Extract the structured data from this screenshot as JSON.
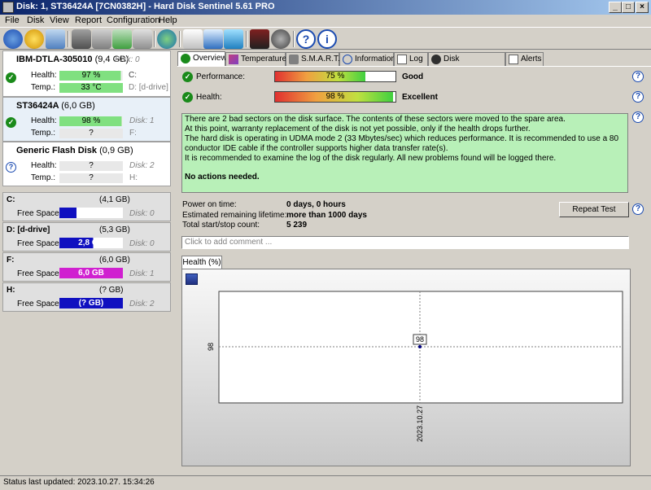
{
  "window": {
    "title": "Disk: 1, ST36424A [7CN0382H]  -  Hard Disk Sentinel 5.61 PRO"
  },
  "menu": [
    "File",
    "Disk",
    "View",
    "Report",
    "Configuration",
    "Help"
  ],
  "disks": [
    {
      "name": "IBM-DTLA-305010",
      "size": "(9,4 GB)",
      "disk_label": "Disk: 0",
      "health_label": "Health:",
      "health": "97 %",
      "health_fraction": 0.97,
      "temp_label": "Temp.:",
      "temp": "33 °C",
      "drive1": "C:",
      "drive2": "D: [d-drive]"
    },
    {
      "name": "ST36424A",
      "size": "(6,0 GB)",
      "disk_label": "Disk: 1",
      "health_label": "Health:",
      "health": "98 %",
      "health_fraction": 0.98,
      "temp_label": "Temp.:",
      "temp": "?",
      "drive1": "F:"
    },
    {
      "name": "Generic Flash Disk",
      "size": "(0,9 GB)",
      "disk_label": "Disk: 2",
      "health_label": "Health:",
      "health": "?",
      "temp_label": "Temp.:",
      "temp": "?",
      "drive1": "H:"
    }
  ],
  "volumes": [
    {
      "name": "C:",
      "size": "(4,1 GB)",
      "free_label": "Free Space",
      "free": "1,1 GB",
      "free_fraction": 0.27,
      "disk": "Disk: 0"
    },
    {
      "name": "D: [d-drive]",
      "size": "(5,3 GB)",
      "free_label": "Free Space",
      "free": "2,8 GB",
      "free_fraction": 0.53,
      "disk": "Disk: 0"
    },
    {
      "name": "F:",
      "size": "(6,0 GB)",
      "free_label": "Free Space",
      "free": "6,0 GB",
      "free_fraction": 1.0,
      "disk": "Disk: 1"
    },
    {
      "name": "H:",
      "size": "(? GB)",
      "free_label": "Free Space",
      "free": "(? GB)",
      "free_fraction": 0.0,
      "disk": "Disk: 2"
    }
  ],
  "tabs": [
    "Overview",
    "Temperature",
    "S.M.A.R.T.",
    "Information",
    "Log",
    "Disk Performance",
    "Alerts"
  ],
  "overview": {
    "performance_label": "Performance:",
    "performance": "75 %",
    "performance_fraction": 0.75,
    "performance_rating": "Good",
    "health_label": "Health:",
    "health": "98 %",
    "health_fraction": 0.98,
    "health_rating": "Excellent",
    "message_lines": [
      "There are 2 bad sectors on the disk surface. The contents of these sectors were moved to the spare area.",
      "At this point, warranty replacement of the disk is not yet possible, only if the health drops further.",
      "The hard disk is operating in UDMA mode 2 (33 Mbytes/sec) which reduces performance. It is recommended to use a 80",
      "conductor IDE cable if the controller supports higher data transfer rate(s).",
      "It is recommended to examine the log of the disk regularly. All new problems found will be logged there."
    ],
    "message_action": "No actions needed.",
    "power_on_label": "Power on time:",
    "power_on": "0 days, 0 hours",
    "lifetime_label": "Estimated remaining lifetime:",
    "lifetime": "more than 1000 days",
    "startstop_label": "Total start/stop count:",
    "startstop": "5 239",
    "repeat_test": "Repeat Test",
    "comment_placeholder": "Click to add comment ...",
    "chart_tab": "Health (%)"
  },
  "chart_data": {
    "type": "scatter",
    "x": [
      "2023.10.27"
    ],
    "values": [
      98
    ],
    "ytick": "98",
    "xtick": "2023.10.27",
    "point_label": "98"
  },
  "status": "Status last updated: 2023.10.27. 15:34:26",
  "colors": {
    "health_green": "#80e080",
    "free_blue": "#1010c0",
    "free_magenta": "#d020d0",
    "message_bg": "#b8f0b8"
  }
}
